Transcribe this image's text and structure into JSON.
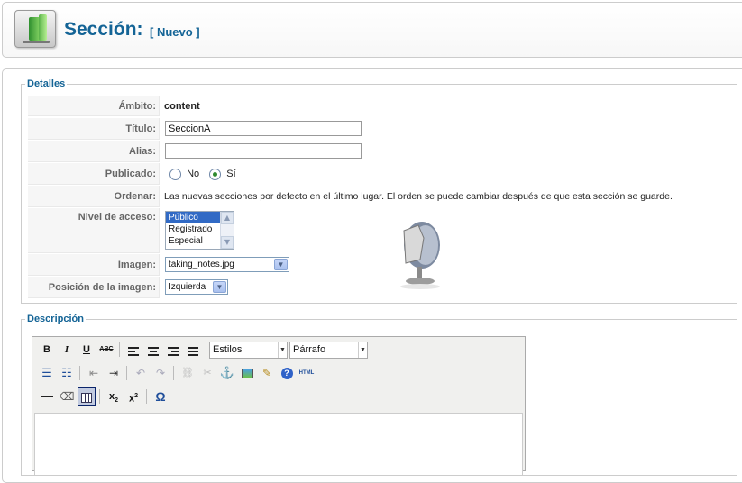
{
  "header": {
    "title": "Sección:",
    "subtitle": "[ Nuevo ]",
    "icon": "section-manager-icon"
  },
  "details": {
    "legend": "Detalles",
    "fields": {
      "ambito": {
        "label": "Ámbito:",
        "value": "content"
      },
      "titulo": {
        "label": "Título:",
        "value": "SeccionA"
      },
      "alias": {
        "label": "Alias:",
        "value": ""
      },
      "publicado": {
        "label": "Publicado:",
        "no": "No",
        "si": "Sí",
        "selected": "Sí"
      },
      "ordenar": {
        "label": "Ordenar:",
        "text": "Las nuevas secciones por defecto en el último lugar. El orden se puede cambiar después de que esta sección se guarde."
      },
      "nivel_acceso": {
        "label": "Nivel de acceso:",
        "options": [
          "Público",
          "Registrado",
          "Especial"
        ],
        "selected": "Público"
      },
      "imagen": {
        "label": "Imagen:",
        "value": "taking_notes.jpg"
      },
      "posicion_imagen": {
        "label": "Posición de la imagen:",
        "value": "Izquierda"
      }
    }
  },
  "description": {
    "legend": "Descripción",
    "toolbar": {
      "estilos": "Estilos",
      "parrafo": "Párrafo",
      "html_label": "HTML",
      "buttons": [
        "bold",
        "italic",
        "underline",
        "strikethrough",
        "align-left",
        "align-center",
        "align-right",
        "align-justify",
        "bullet-list",
        "numbered-list",
        "outdent",
        "indent",
        "undo",
        "redo",
        "link",
        "unlink",
        "anchor",
        "image",
        "cleanup",
        "help",
        "html",
        "horizontal-rule",
        "remove-format",
        "visual-aid",
        "subscript",
        "superscript",
        "special-char"
      ]
    }
  }
}
